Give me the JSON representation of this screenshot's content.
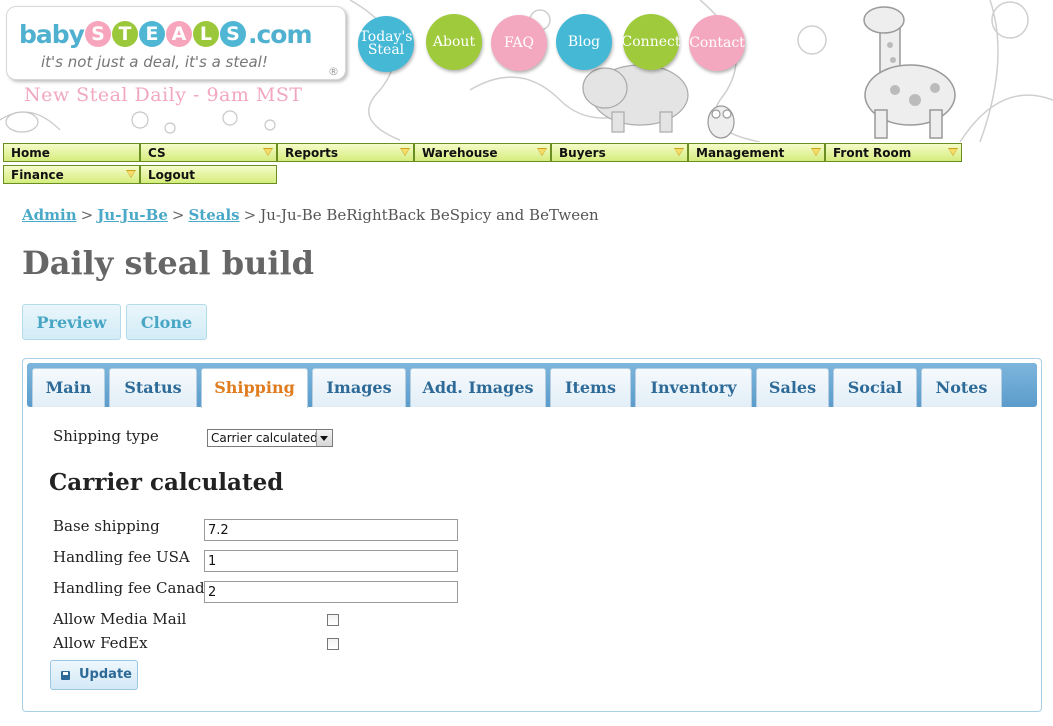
{
  "header": {
    "logo": {
      "prefix": "baby",
      "letters": [
        "S",
        "T",
        "E",
        "A",
        "L",
        "S"
      ],
      "letter_colors": [
        "#f7a5bd",
        "#9bc83a",
        "#4fb6d4",
        "#f7a5bd",
        "#9bc83a",
        "#4fb6d4"
      ],
      "suffix": ".com",
      "tagline": "it's not just a deal, it's a steal!",
      "registered": "®"
    },
    "new_steal": "New Steal Daily - 9am MST",
    "nav": [
      {
        "label": "Today's Steal",
        "color": "#45b8d6"
      },
      {
        "label": "About",
        "color": "#9fca3c"
      },
      {
        "label": "FAQ",
        "color": "#f4a8bf"
      },
      {
        "label": "Blog",
        "color": "#45b8d6"
      },
      {
        "label": "Connect",
        "color": "#9fca3c"
      },
      {
        "label": "Contact",
        "color": "#f4a8bf"
      }
    ]
  },
  "menu": {
    "row1": [
      "Home",
      "CS",
      "Reports",
      "Warehouse",
      "Buyers",
      "Management",
      "Front Room"
    ],
    "row2": [
      "Finance",
      "Logout"
    ]
  },
  "breadcrumb": {
    "admin": "Admin",
    "brand": "Ju-Ju-Be",
    "steals": "Steals",
    "current": "Ju-Ju-Be BeRightBack BeSpicy and BeTween",
    "separator": ">"
  },
  "page_title": "Daily steal build",
  "actions": {
    "preview": "Preview",
    "clone": "Clone"
  },
  "tabs": [
    "Main",
    "Status",
    "Shipping",
    "Images",
    "Add. Images",
    "Items",
    "Inventory",
    "Sales",
    "Social",
    "Notes"
  ],
  "active_tab": "Shipping",
  "form": {
    "shipping_type_label": "Shipping type",
    "shipping_type_value": "Carrier calculated",
    "section_title": "Carrier calculated",
    "base_shipping_label": "Base shipping",
    "base_shipping_value": "7.2",
    "handling_usa_label": "Handling fee USA",
    "handling_usa_value": "1",
    "handling_canada_label": "Handling fee Canada",
    "handling_canada_value": "2",
    "media_mail_label": "Allow Media Mail",
    "fedex_label": "Allow FedEx",
    "update_label": "Update"
  },
  "colors": {
    "link": "#4aa8c8",
    "active_tab_text": "#e07b1e",
    "tab_text": "#2e6a97",
    "menu_bg": "#d6ec7e"
  }
}
